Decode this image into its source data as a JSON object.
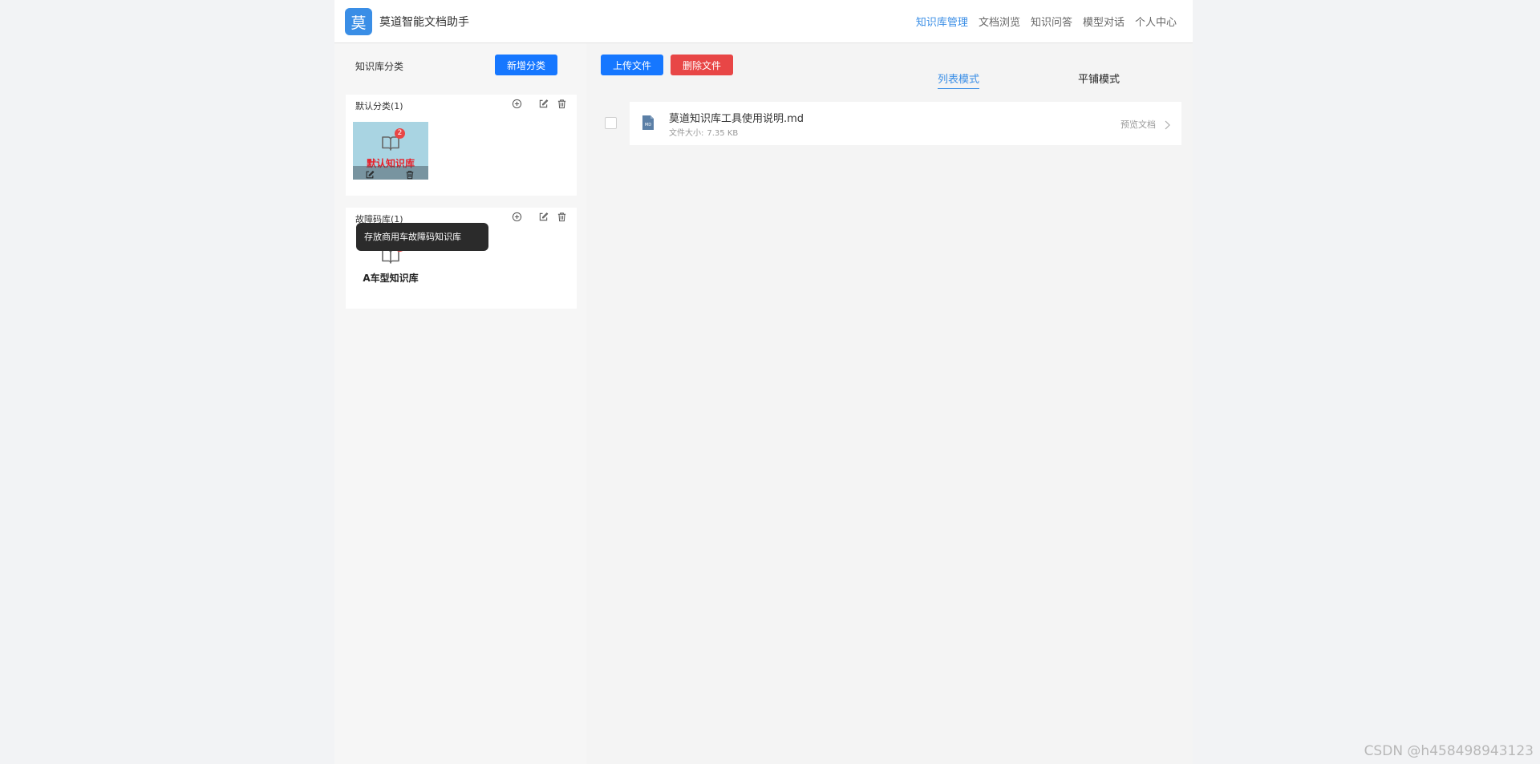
{
  "header": {
    "logo_char": "莫",
    "app_title": "莫道智能文档助手",
    "nav": [
      {
        "label": "知识库管理",
        "active": true
      },
      {
        "label": "文档浏览",
        "active": false
      },
      {
        "label": "知识问答",
        "active": false
      },
      {
        "label": "模型对话",
        "active": false
      },
      {
        "label": "个人中心",
        "active": false
      }
    ]
  },
  "left_panel": {
    "title": "知识库分类",
    "add_category_label": "新增分类",
    "categories": [
      {
        "name": "默认分类(1)",
        "knowledge_bases": [
          {
            "name": "默认知识库",
            "badge": "2",
            "highlighted": true
          }
        ]
      },
      {
        "name": "故障码库(1)",
        "tooltip": "存放商用车故障码知识库",
        "knowledge_bases": [
          {
            "name": "A车型知识库",
            "badge": "0",
            "highlighted": false
          }
        ]
      }
    ]
  },
  "right_panel": {
    "upload_label": "上传文件",
    "delete_label": "删除文件",
    "view_modes": [
      {
        "label": "列表模式",
        "active": true
      },
      {
        "label": "平铺模式",
        "active": false
      }
    ],
    "files": [
      {
        "name": "莫道知识库工具使用说明.md",
        "size_label": "文件大小:",
        "size_value": "7.35 KB",
        "preview_label": "预览文档"
      }
    ]
  },
  "watermark": "CSDN @h458498943123",
  "colors": {
    "primary": "#1677ff",
    "danger": "#e84646",
    "active_nav": "#3a8ee6",
    "highlight_card": "#a9d4e2"
  }
}
